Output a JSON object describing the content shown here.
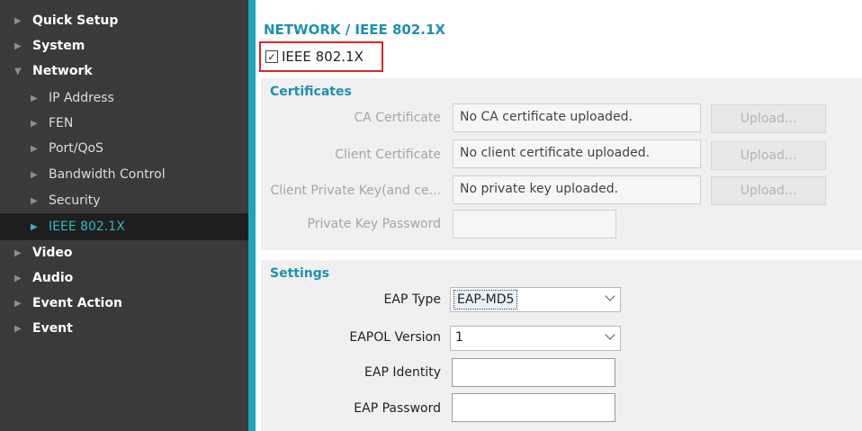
{
  "sidebar": {
    "items": [
      {
        "label": "Quick Setup",
        "arrow": "▶"
      },
      {
        "label": "System",
        "arrow": "▶"
      },
      {
        "label": "Network",
        "arrow": "▼"
      },
      {
        "label": "IP Address",
        "arrow": "▶"
      },
      {
        "label": "FEN",
        "arrow": "▶"
      },
      {
        "label": "Port/QoS",
        "arrow": "▶"
      },
      {
        "label": "Bandwidth Control",
        "arrow": "▶"
      },
      {
        "label": "Security",
        "arrow": "▶"
      },
      {
        "label": "IEEE 802.1X",
        "arrow": "▶",
        "selected": true
      },
      {
        "label": "Video",
        "arrow": "▶"
      },
      {
        "label": "Audio",
        "arrow": "▶"
      },
      {
        "label": "Event Action",
        "arrow": "▶"
      },
      {
        "label": "Event",
        "arrow": "▶"
      }
    ]
  },
  "page": {
    "title": "NETWORK / IEEE 802.1X",
    "enable": {
      "label": "IEEE 802.1X",
      "checked": true,
      "check_glyph": "✓"
    }
  },
  "certificates": {
    "title": "Certificates",
    "ca": {
      "label": "CA Certificate",
      "value": "No CA certificate uploaded.",
      "button": "Upload..."
    },
    "client": {
      "label": "Client Certificate",
      "value": "No client certificate uploaded.",
      "button": "Upload..."
    },
    "private_key": {
      "label": "Client Private Key(and ce...",
      "value": "No private key uploaded.",
      "button": "Upload..."
    },
    "key_password": {
      "label": "Private Key Password",
      "value": ""
    }
  },
  "settings": {
    "title": "Settings",
    "eap_type": {
      "label": "EAP Type",
      "value": "EAP-MD5"
    },
    "eapol_version": {
      "label": "EAPOL Version",
      "value": "1"
    },
    "eap_identity": {
      "label": "EAP Identity",
      "value": ""
    },
    "eap_password": {
      "label": "EAP Password",
      "value": ""
    }
  },
  "colors": {
    "accent": "#1fa5b5",
    "title": "#1f8fb0",
    "sidebar_bg": "#3a3a3a",
    "highlight_border": "#e02424"
  }
}
